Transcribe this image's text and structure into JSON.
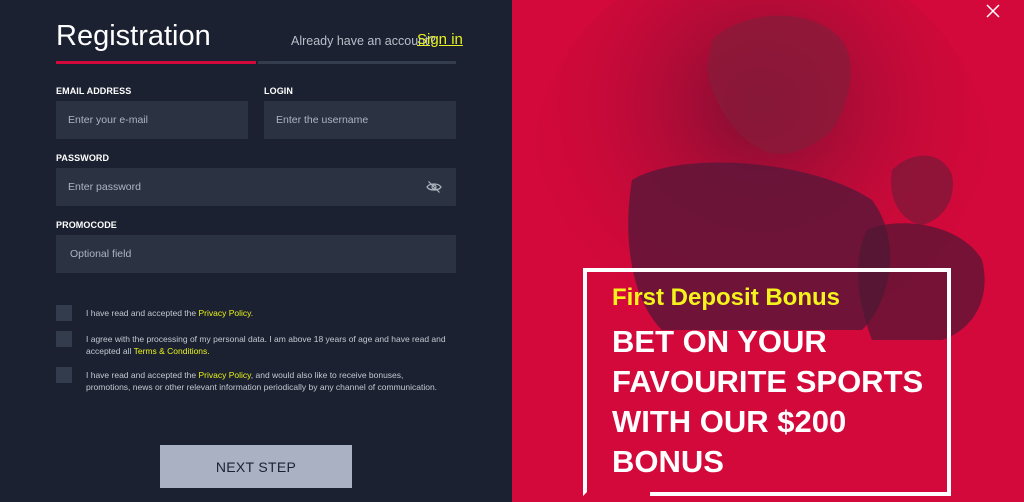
{
  "form": {
    "title": "Registration",
    "already_text": "Already have an account?",
    "signin_link": "Sign in",
    "email": {
      "label": "EMAIL ADDRESS",
      "placeholder": "Enter your e-mail"
    },
    "login": {
      "label": "LOGIN",
      "placeholder": "Enter the username"
    },
    "password": {
      "label": "PASSWORD",
      "placeholder": "Enter password"
    },
    "promocode": {
      "label": "PROMOCODE",
      "placeholder": "Optional field"
    },
    "consents": [
      {
        "pre": "I have read and accepted the",
        "link": "Privacy Policy.",
        "post": ""
      },
      {
        "pre": "I agree with the processing of my personal data. I am above 18 years of age and have read and accepted all",
        "link": "Terms & Conditions.",
        "post": ""
      },
      {
        "pre": "I have read and accepted the",
        "link": "Privacy Policy",
        "post": ", and would also like to receive bonuses, promotions, news or other relevant information periodically by any channel of communication."
      }
    ],
    "next_button": "NEXT STEP"
  },
  "promo": {
    "subtitle": "First Deposit Bonus",
    "headline": "BET ON YOUR FAVOURITE SPORTS WITH OUR $200 BONUS"
  },
  "colors": {
    "accent_red": "#d2093a",
    "link_yellow": "#e9f21c",
    "panel_dark": "#1b2130",
    "input_bg": "#2b3343"
  },
  "icons": [
    "eye-slash-icon",
    "close-icon"
  ]
}
